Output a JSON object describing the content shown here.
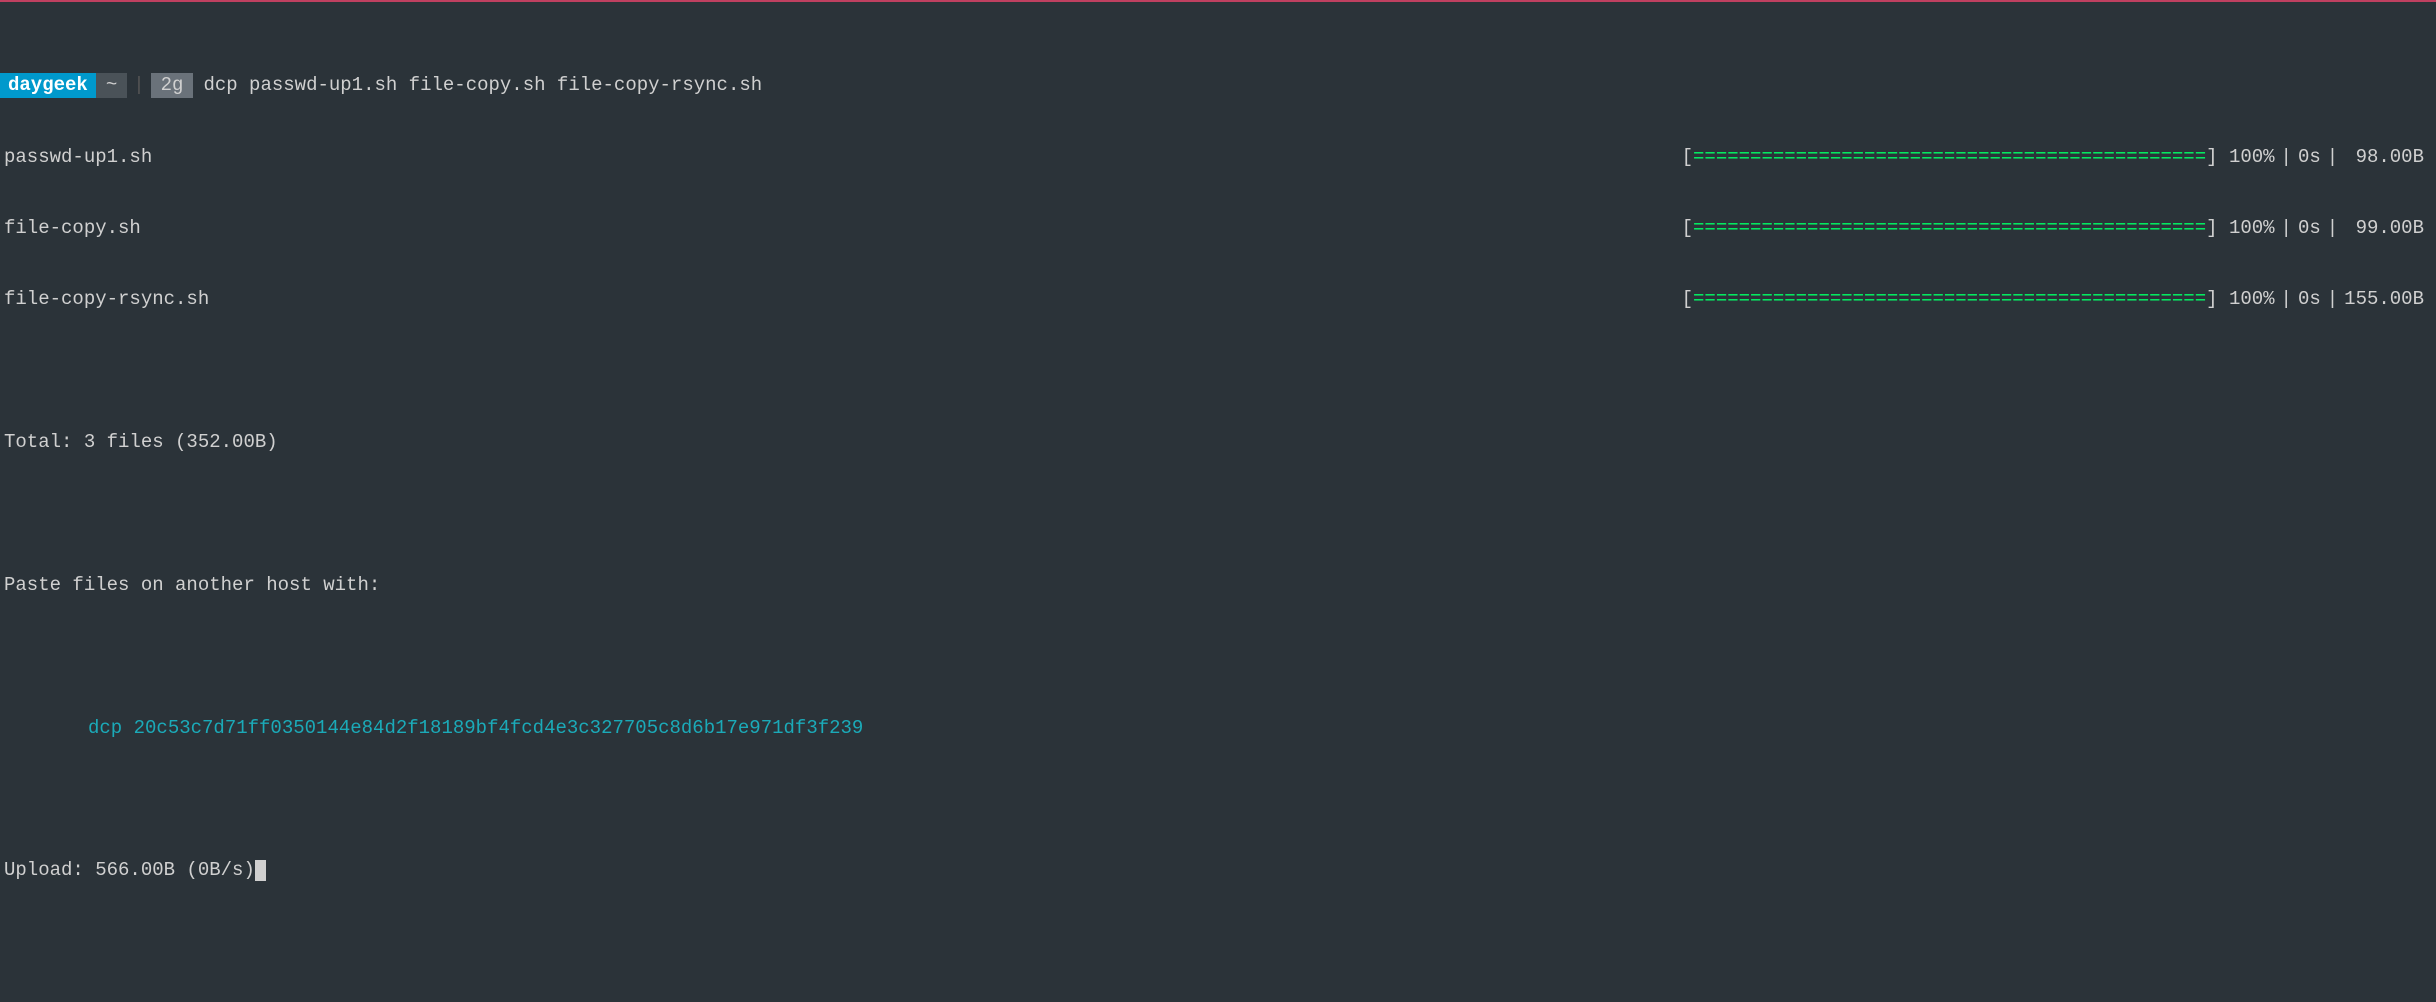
{
  "prompt": {
    "user": "daygeek",
    "path": "~",
    "git": "2g",
    "command": "dcp passwd-up1.sh file-copy.sh file-copy-rsync.sh"
  },
  "files": [
    {
      "name": "passwd-up1.sh",
      "bar": "=============================================",
      "pct": "100%",
      "time": "0s",
      "size": " 98.00B"
    },
    {
      "name": "file-copy.sh",
      "bar": "=============================================",
      "pct": "100%",
      "time": "0s",
      "size": " 99.00B"
    },
    {
      "name": "file-copy-rsync.sh",
      "bar": "=============================================",
      "pct": "100%",
      "time": "0s",
      "size": "155.00B"
    }
  ],
  "total": "Total: 3 files (352.00B)",
  "paste_msg": "Paste files on another host with:",
  "hash_cmd": "dcp 20c53c7d71ff0350144e84d2f18189bf4fcd4e3c327705c8d6b17e971df3f239",
  "upload": "Upload: 566.00B (0B/s)"
}
